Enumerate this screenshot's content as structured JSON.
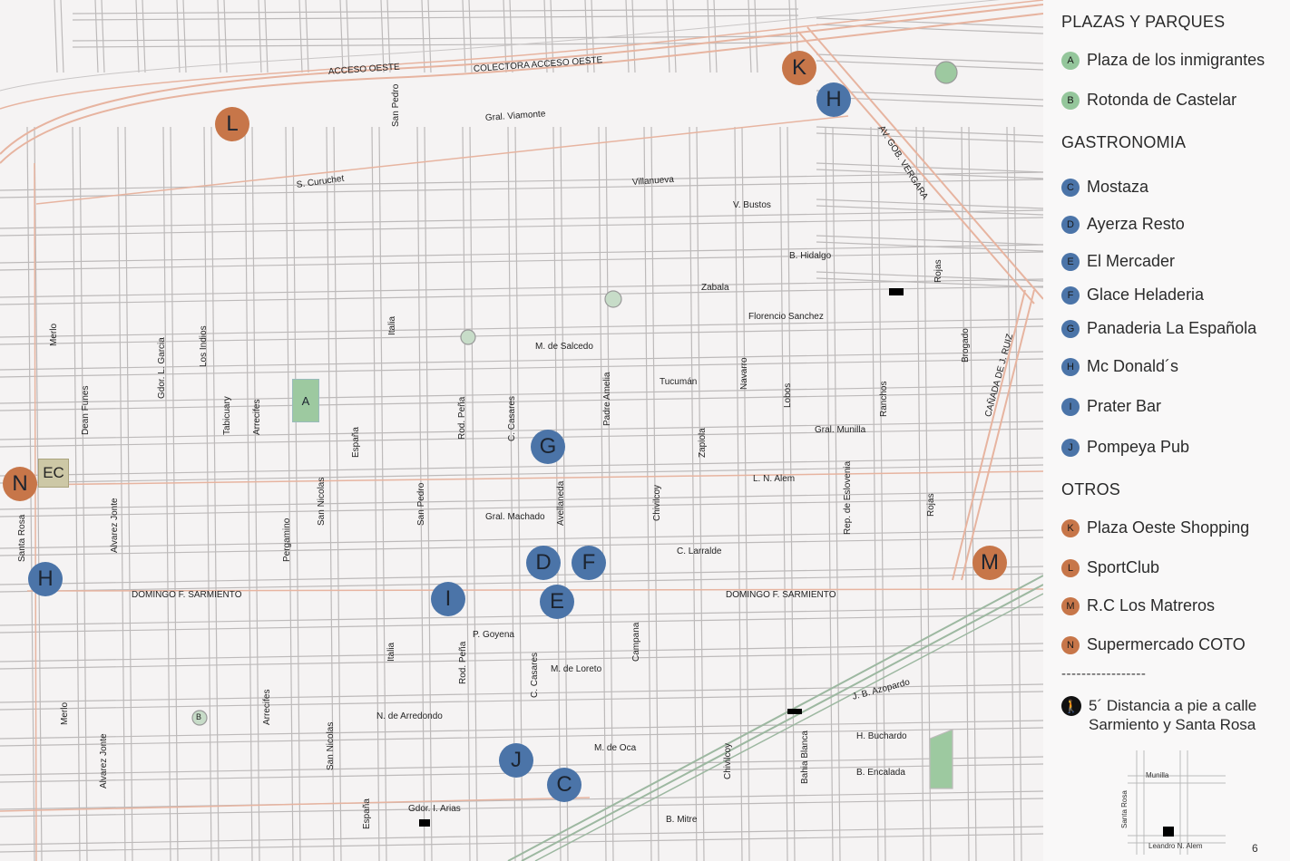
{
  "map": {
    "streets": [
      {
        "text": "ACCESO OESTE"
      },
      {
        "text": "COLECTORA ACCESO OESTE"
      },
      {
        "text": "Gral. Viamonte"
      },
      {
        "text": "S. Curuchet"
      },
      {
        "text": "Villanueva"
      },
      {
        "text": "V. Bustos"
      },
      {
        "text": "B. Hidalgo"
      },
      {
        "text": "Zabala"
      },
      {
        "text": "Florencio Sanchez"
      },
      {
        "text": "M. de Salcedo"
      },
      {
        "text": "Tucumán"
      },
      {
        "text": "Gral. Munilla"
      },
      {
        "text": "L. N. Alem"
      },
      {
        "text": "Gral. Machado"
      },
      {
        "text": "C. Larralde"
      },
      {
        "text": "DOMINGO F. SARMIENTO"
      },
      {
        "text": "DOMINGO F. SARMIENTO"
      },
      {
        "text": "P. Goyena"
      },
      {
        "text": "M. de Loreto"
      },
      {
        "text": "N. de Arredondo"
      },
      {
        "text": "M. de Oca"
      },
      {
        "text": "J. B. Azopardo"
      },
      {
        "text": "H. Buchardo"
      },
      {
        "text": "B. Encalada"
      },
      {
        "text": "B. Mitre"
      },
      {
        "text": "Gdor. I. Arias"
      },
      {
        "text": "AV. GOB. VERGARA"
      },
      {
        "text": "CAÑADA DE J. RUIZ"
      },
      {
        "text": "San Pedro"
      },
      {
        "text": "Merlo"
      },
      {
        "text": "Los Indios"
      },
      {
        "text": "Italia"
      },
      {
        "text": "Gdor. L. Garcia"
      },
      {
        "text": "Dean Funes"
      },
      {
        "text": "Tabicuary"
      },
      {
        "text": "Arrecifes"
      },
      {
        "text": "España"
      },
      {
        "text": "Rod. Peña"
      },
      {
        "text": "C. Casares"
      },
      {
        "text": "Padre Amelia"
      },
      {
        "text": "Zapiola"
      },
      {
        "text": "Navarro"
      },
      {
        "text": "Lobos"
      },
      {
        "text": "Ranchos"
      },
      {
        "text": "Rojas"
      },
      {
        "text": "Brogado"
      },
      {
        "text": "Santa Rosa"
      },
      {
        "text": "Alvarez Jonte"
      },
      {
        "text": "Pergamino"
      },
      {
        "text": "San Nicolas"
      },
      {
        "text": "San Pedro"
      },
      {
        "text": "Avellaneda"
      },
      {
        "text": "Chivilcoy"
      },
      {
        "text": "Rep. de Eslovenia"
      },
      {
        "text": "Rojas"
      },
      {
        "text": "Italia"
      },
      {
        "text": "Rod. Peña"
      },
      {
        "text": "C. Casares"
      },
      {
        "text": "Campana"
      },
      {
        "text": "Merlo"
      },
      {
        "text": "Alvarez Jonte"
      },
      {
        "text": "Arrecifes"
      },
      {
        "text": "San Nicolas"
      },
      {
        "text": "España"
      },
      {
        "text": "Chivilcoy"
      },
      {
        "text": "Bahia Blanca"
      }
    ],
    "markers": [
      {
        "letter": "K",
        "kind": "orange"
      },
      {
        "letter": "H",
        "kind": "blue"
      },
      {
        "letter": "L",
        "kind": "orange"
      },
      {
        "letter": "G",
        "kind": "blue"
      },
      {
        "letter": "N",
        "kind": "orange"
      },
      {
        "letter": "H",
        "kind": "blue"
      },
      {
        "letter": "D",
        "kind": "blue"
      },
      {
        "letter": "F",
        "kind": "blue"
      },
      {
        "letter": "I",
        "kind": "blue"
      },
      {
        "letter": "E",
        "kind": "blue"
      },
      {
        "letter": "M",
        "kind": "orange"
      },
      {
        "letter": "J",
        "kind": "blue"
      },
      {
        "letter": "C",
        "kind": "blue"
      }
    ],
    "plaza_a": "A",
    "rotonda_b": "B",
    "ec_label": "EC"
  },
  "legend": {
    "sections": [
      {
        "title": "PLAZAS Y PARQUES",
        "items": [
          {
            "letter": "A",
            "label": "Plaza de los inmigrantes",
            "color": "green"
          },
          {
            "letter": "B",
            "label": "Rotonda de Castelar",
            "color": "green"
          }
        ]
      },
      {
        "title": "GASTRONOMIA",
        "items": [
          {
            "letter": "C",
            "label": "Mostaza",
            "color": "blue"
          },
          {
            "letter": "D",
            "label": "Ayerza Resto",
            "color": "blue"
          },
          {
            "letter": "E",
            "label": "El Mercader",
            "color": "blue"
          },
          {
            "letter": "F",
            "label": "Glace Heladeria",
            "color": "blue"
          },
          {
            "letter": "G",
            "label": "Panaderia La Española",
            "color": "blue"
          },
          {
            "letter": "H",
            "label": "Mc Donald´s",
            "color": "blue"
          },
          {
            "letter": "I",
            "label": "Prater Bar",
            "color": "blue"
          },
          {
            "letter": "J",
            "label": "Pompeya Pub",
            "color": "blue"
          }
        ]
      },
      {
        "title": "OTROS",
        "items": [
          {
            "letter": "K",
            "label": "Plaza Oeste Shopping",
            "color": "orange"
          },
          {
            "letter": "L",
            "label": "SportClub",
            "color": "orange"
          },
          {
            "letter": "M",
            "label": "R.C Los Matreros",
            "color": "orange"
          },
          {
            "letter": "N",
            "label": "Supermercado COTO",
            "color": "orange"
          }
        ]
      }
    ],
    "separator": "-----------------",
    "walk_note_line1": "5´ Distancia a pie a calle",
    "walk_note_line2": "Sarmiento y Santa Rosa",
    "mini_map": {
      "street_h": "Munilla",
      "street_v": "Santa Rosa",
      "street_bottom": "Leandro N. Alem"
    },
    "page_number": "6"
  },
  "colors": {
    "blue_marker": "#4b74a8",
    "orange_marker": "#c77649",
    "green_marker": "#94c69b",
    "major_road": "#e7b4a0"
  }
}
